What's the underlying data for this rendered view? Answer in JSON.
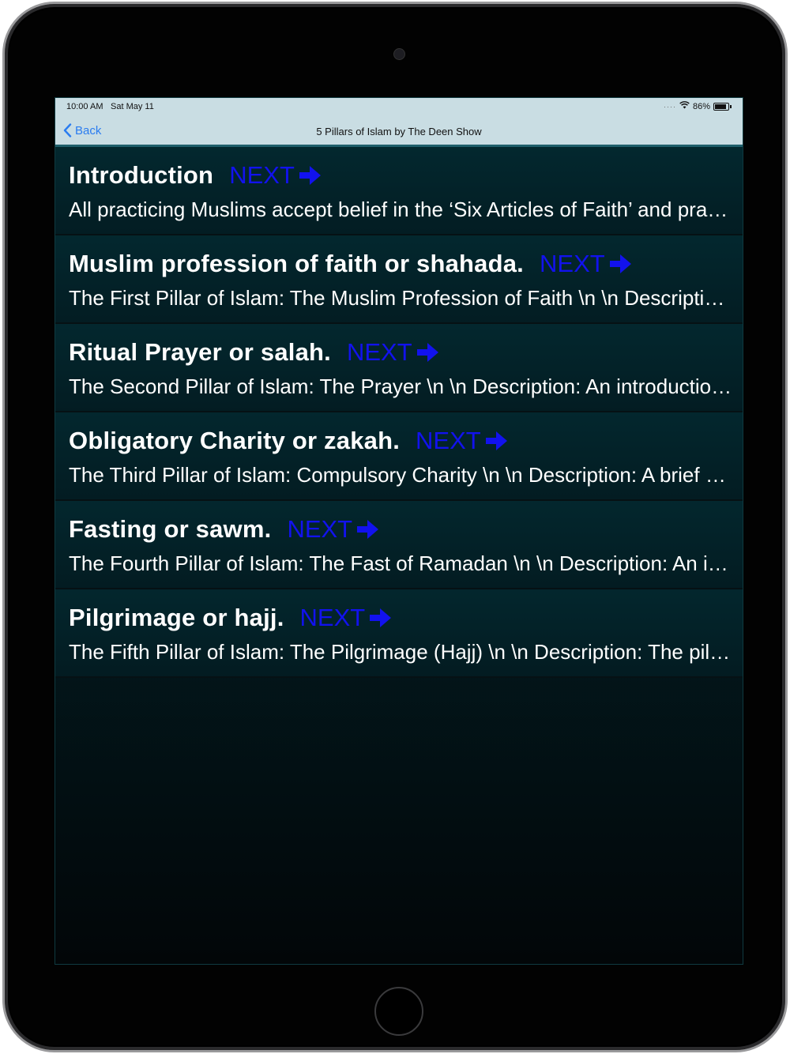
{
  "status": {
    "time": "10:00 AM",
    "date": "Sat May 11",
    "battery": "86%",
    "battery_level": 0.86
  },
  "nav": {
    "back_label": "Back",
    "title": "5 Pillars of Islam by The Deen Show"
  },
  "items": [
    {
      "title": "Introduction",
      "next_label": "NEXT",
      "description": "All practicing Muslims accept belief in the ‘Six Articles of Faith’ and practice the Five Pillars of Islam"
    },
    {
      "title": "Muslim profession of faith or shahada.",
      "next_label": "NEXT",
      "description": "The First Pillar of Islam: The Muslim Profession of Faith \\n \\n Description: The testimony of faith"
    },
    {
      "title": "Ritual Prayer or salah.",
      "next_label": "NEXT",
      "description": "The Second Pillar of Islam: The Prayer \\n \\n Description: An introduction to the prayer"
    },
    {
      "title": "Obligatory Charity or zakah.",
      "next_label": "NEXT",
      "description": "The Third Pillar of Islam: Compulsory Charity \\n \\n Description: A brief overview of zakah"
    },
    {
      "title": "Fasting or sawm.",
      "next_label": "NEXT",
      "description": "The Fourth Pillar of Islam: The Fast of Ramadan \\n \\n  Description: An introduction to fasting"
    },
    {
      "title": "Pilgrimage or hajj.",
      "next_label": "NEXT",
      "description": "The Fifth Pillar of Islam: The Pilgrimage (Hajj) \\n \\n Description: The pilgrimage to Makkah"
    }
  ],
  "icons": {
    "back": "chevron-left-icon",
    "next": "arrow-right-icon",
    "wifi": "wifi-icon",
    "battery": "battery-icon"
  },
  "colors": {
    "accent_link": "#2a7cf0",
    "next": "#1212ee",
    "nav_bg": "#c9dde3",
    "row_bg": "#032a31"
  }
}
